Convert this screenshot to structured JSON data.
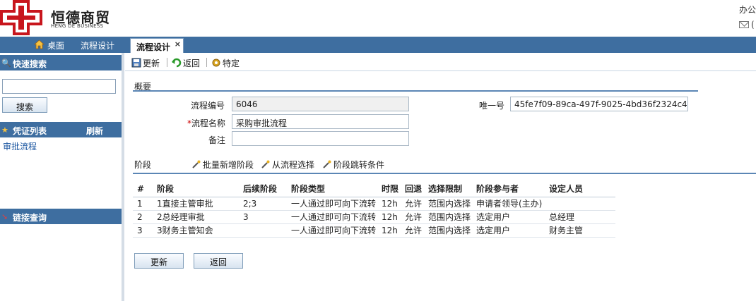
{
  "header": {
    "brand_cn": "恒德商贸",
    "brand_en": "HENG DE BUSINESS",
    "top_right": "办公",
    "mail_paren": "("
  },
  "nav": {
    "items": [
      {
        "label": "桌面"
      },
      {
        "label": "流程设计"
      }
    ],
    "active_tab": {
      "label": "流程设计",
      "close": "×"
    }
  },
  "sidebar": {
    "quick_search": {
      "title": "快速搜索",
      "button": "搜索"
    },
    "voucher": {
      "title": "凭证列表",
      "refresh": "刷新",
      "items": [
        "审批流程"
      ]
    },
    "links": {
      "title": "链接查询"
    }
  },
  "toolbar": {
    "update": "更新",
    "back": "返回",
    "special": "特定"
  },
  "overview": {
    "title": "概要",
    "id_label": "流程编号",
    "id_value": "6046",
    "name_required": "*",
    "name_label": "流程名称",
    "name_value": "采购审批流程",
    "note_label": "备注",
    "note_value": "",
    "uid_label": "唯一号",
    "uid_value": "45fe7f09-89ca-497f-9025-4bd36f2324c4"
  },
  "stages": {
    "title": "阶段",
    "actions": [
      "批量新增阶段",
      "从流程选择",
      "阶段跳转条件"
    ],
    "columns": [
      "#",
      "阶段",
      "后续阶段",
      "阶段类型",
      "时限",
      "回退",
      "选择限制",
      "阶段参与者",
      "设定人员"
    ],
    "rows": [
      [
        "1",
        "1直接主管审批",
        "2;3",
        "一人通过即可向下流转",
        "12h",
        "允许",
        "范围内选择",
        "申请者领导(主办)",
        ""
      ],
      [
        "2",
        "2总经理审批",
        "3",
        "一人通过即可向下流转",
        "12h",
        "允许",
        "范围内选择",
        "选定用户",
        "总经理"
      ],
      [
        "3",
        "3财务主管知会",
        "",
        "一人通过即可向下流转",
        "12h",
        "允许",
        "范围内选择",
        "选定用户",
        "财务主管"
      ]
    ]
  },
  "footer": {
    "update": "更新",
    "back": "返回"
  },
  "colors": {
    "nav_bg": "#3e6ea0",
    "logo_red": "#c8161d",
    "link": "#1a55a0"
  }
}
